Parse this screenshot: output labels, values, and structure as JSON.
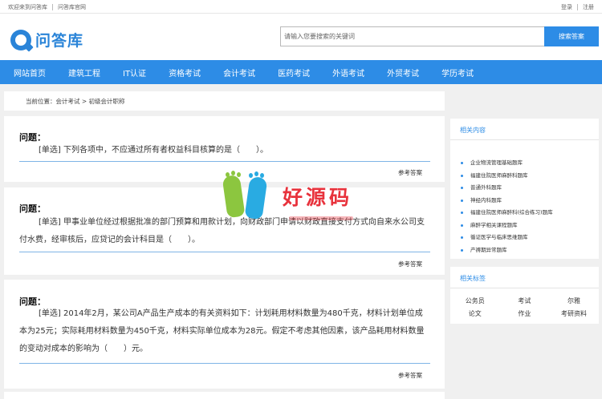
{
  "topbar": {
    "welcome": "欢迎来到问答库",
    "official": "问答库官网",
    "login": "登录",
    "register": "注册"
  },
  "logo": {
    "text": "问答库",
    "icon": "q-logo-icon"
  },
  "search": {
    "placeholder": "请输入您要搜索的关键词",
    "button": "搜索答案"
  },
  "nav": [
    "网站首页",
    "建筑工程",
    "IT认证",
    "资格考试",
    "会计考试",
    "医药考试",
    "外语考试",
    "外贸考试",
    "学历考试"
  ],
  "breadcrumb": "当前位置：会计考试 > 初级会计职称",
  "questions": [
    {
      "title": "问题：",
      "text": "[单选] 下列各项中，不应通过所有者权益科目核算的是（　　）。",
      "answer": "参考答案"
    },
    {
      "title": "问题：",
      "text": "[单选] 甲事业单位经过根据批准的部门预算和用款计划，向财政部门申请以财政直接支付方式向自来水公司支付水费，经审核后，应贷记的会计科目是（　　）。",
      "answer": "参考答案"
    },
    {
      "title": "问题：",
      "text": "[单选] 2014年2月，某公司A产品生产成本的有关资料如下：计划耗用材料数量为480千克，材料计划单位成本为25元；实际耗用材料数量为450千克，材料实际单位成本为28元。假定不考虑其他因素，该产品耗用材料数量的变动对成本的影响为（　　）元。",
      "answer": "参考答案"
    }
  ],
  "related": {
    "title": "相关内容",
    "items": [
      "企业物流管理基础题库",
      "福建住院医师麻醉科题库",
      "普通外科题库",
      "神经内科题库",
      "福建住院医师麻醉科(综合练习)题库",
      "麻醉学相关课程题库",
      "循证医学与临床思维题库",
      "产褥期异常题库"
    ]
  },
  "tags": {
    "title": "相关标签",
    "rows": [
      [
        "公务员",
        "考试",
        "尔雅"
      ],
      [
        "论文",
        "作业",
        "考研资料"
      ]
    ]
  },
  "watermark": {
    "brand": "好源码"
  },
  "colors": {
    "accent": "#2d8ce6",
    "watermark_red": "#e8323c",
    "watermark_green": "#8cc63f",
    "watermark_blue": "#29abe2"
  }
}
